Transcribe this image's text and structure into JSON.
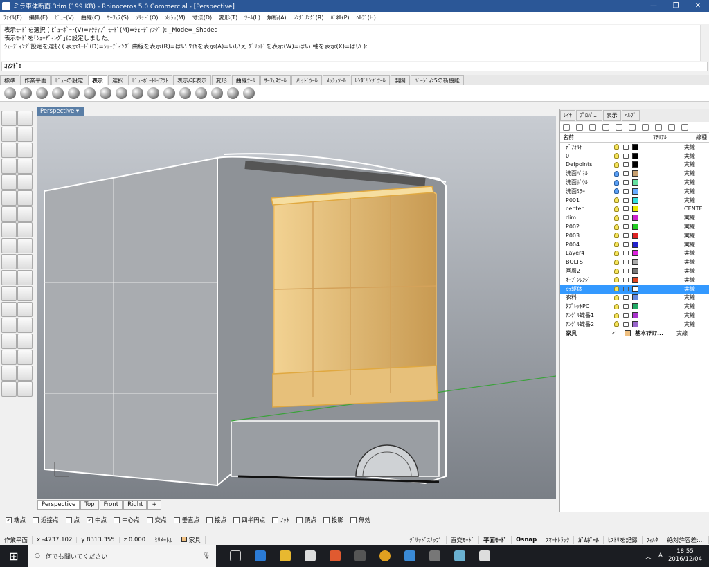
{
  "window": {
    "title": "ミラ車体断面.3dm (199 KB) - Rhinoceros 5.0 Commercial - [Perspective]",
    "minimize": "—",
    "maximize": "❐",
    "close": "✕"
  },
  "menu": [
    "ﾌｧｲﾙ(F)",
    "編集(E)",
    "ﾋﾞｭｰ(V)",
    "曲線(C)",
    "ｻｰﾌｪｽ(S)",
    "ｿﾘｯﾄﾞ(O)",
    "ﾒｯｼｭ(M)",
    "寸法(D)",
    "変形(T)",
    "ﾂｰﾙ(L)",
    "解析(A)",
    "ﾚﾝﾀﾞﾘﾝｸﾞ(R)",
    "ﾊﾟﾈﾙ(P)",
    "ﾍﾙﾌﾟ(H)"
  ],
  "command_history": [
    "表示ﾓｰﾄﾞを選択 ( ﾋﾞｭｰﾎﾟｰﾄ(V)=ｱｸﾃｨﾌﾞ ﾓｰﾄﾞ(M)=ｼｪｰﾃﾞｨﾝｸﾞ ): _Mode=_Shaded",
    "表示ﾓｰﾄﾞを｢ｼｪｰﾃﾞｨﾝｸﾞ｣に設定しました。",
    "ｼｪｰﾃﾞｨﾝｸﾞ設定を選択 ( 表示ﾓｰﾄﾞ(D)=ｼｪｰﾃﾞｨﾝｸﾞ 曲線を表示(R)=はい ﾜｲﾔを表示(A)=いいえ ｸﾞﾘｯﾄﾞを表示(W)=はい 軸を表示(X)=はい ):"
  ],
  "command_prompt": "ｺﾏﾝﾄﾞ:",
  "toolbar_tabs": [
    "標準",
    "作業平面",
    "ﾋﾞｭｰの設定",
    "表示",
    "選択",
    "ﾋﾞｭｰﾎﾟｰﾄﾚｲｱｳﾄ",
    "表示/非表示",
    "変形",
    "曲線ﾂｰﾙ",
    "ｻｰﾌｪｽﾂｰﾙ",
    "ｿﾘｯﾄﾞﾂｰﾙ",
    "ﾒｯｼｭﾂｰﾙ",
    "ﾚﾝﾀﾞﾘﾝｸﾞﾂｰﾙ",
    "製図",
    "ﾊﾞｰｼﾞｮﾝ5の新機能"
  ],
  "active_tab": "表示",
  "viewport": {
    "label": "Perspective",
    "tabs": [
      "Perspective",
      "Top",
      "Front",
      "Right"
    ],
    "add_tab": "+"
  },
  "panel": {
    "tabs": [
      "ﾚｲﾔ",
      "ﾌﾟﾛﾊﾟ...",
      "表示",
      "ﾍﾙﾌﾟ"
    ],
    "columns": {
      "name": "名前",
      "material": "ﾏﾃﾘｱﾙ",
      "linetype": "線種"
    },
    "layers": [
      {
        "name": "ﾃﾞﾌｫﾙﾄ",
        "color": "#000000",
        "bulb": "yellow",
        "linetype": "実線"
      },
      {
        "name": "0",
        "color": "#000000",
        "bulb": "yellow",
        "linetype": "実線"
      },
      {
        "name": "Defpoints",
        "color": "#000000",
        "bulb": "yellow",
        "linetype": "実線"
      },
      {
        "name": "洗面ﾊﾟﾈﾙ",
        "color": "#c8a070",
        "bulb": "blue",
        "linetype": "実線"
      },
      {
        "name": "洗面ﾎﾞｳﾙ",
        "color": "#66e0a0",
        "bulb": "blue",
        "linetype": "実線"
      },
      {
        "name": "洗面ﾐﾗｰ",
        "color": "#66aaff",
        "bulb": "blue",
        "linetype": "実線"
      },
      {
        "name": "P001",
        "color": "#33dddd",
        "bulb": "yellow",
        "linetype": "実線"
      },
      {
        "name": "center",
        "color": "#e8e800",
        "bulb": "yellow",
        "linetype": "CENTE"
      },
      {
        "name": "dim",
        "color": "#cc22cc",
        "bulb": "yellow",
        "linetype": "実線"
      },
      {
        "name": "P002",
        "color": "#22cc22",
        "bulb": "yellow",
        "linetype": "実線"
      },
      {
        "name": "P003",
        "color": "#dd2222",
        "bulb": "yellow",
        "linetype": "実線"
      },
      {
        "name": "P004",
        "color": "#2222cc",
        "bulb": "yellow",
        "linetype": "実線"
      },
      {
        "name": "Layer4",
        "color": "#dd22dd",
        "bulb": "yellow",
        "linetype": "実線"
      },
      {
        "name": "BOLTS",
        "color": "#aaaaaa",
        "bulb": "yellow",
        "linetype": "実線"
      },
      {
        "name": "画層2",
        "color": "#777777",
        "bulb": "yellow",
        "linetype": "実線"
      },
      {
        "name": "ｵｰﾌﾟﾝﾚﾝｼﾞ",
        "color": "#dd4422",
        "bulb": "yellow",
        "linetype": "実線"
      },
      {
        "name": "ﾐﾗ躯体",
        "color": "#ffffff",
        "bulb": "yellow",
        "linetype": "実線",
        "selected": true
      },
      {
        "name": "衣料",
        "color": "#6688dd",
        "bulb": "yellow",
        "linetype": "実線"
      },
      {
        "name": "ﾀﾌﾞﾚｯﾄPC",
        "color": "#22aa66",
        "bulb": "yellow",
        "linetype": "実線"
      },
      {
        "name": "ｱﾝｸﾞﾙ蝶番1",
        "color": "#aa33cc",
        "bulb": "yellow",
        "linetype": "実線"
      },
      {
        "name": "ｱﾝｸﾞﾙ蝶番2",
        "color": "#9966cc",
        "bulb": "yellow",
        "linetype": "実線"
      },
      {
        "name": "家具",
        "color": "#f0c080",
        "bulb": "none",
        "linetype": "実線",
        "check": "✓",
        "material": "基本ﾏﾃﾘｱ..."
      }
    ]
  },
  "osnap": [
    {
      "label": "端点",
      "checked": true
    },
    {
      "label": "近接点",
      "checked": false
    },
    {
      "label": "点",
      "checked": false
    },
    {
      "label": "中点",
      "checked": true
    },
    {
      "label": "中心点",
      "checked": false
    },
    {
      "label": "交点",
      "checked": false
    },
    {
      "label": "垂直点",
      "checked": false
    },
    {
      "label": "接点",
      "checked": false
    },
    {
      "label": "四半円点",
      "checked": false
    },
    {
      "label": "ﾉｯﾄ",
      "checked": false
    },
    {
      "label": "頂点",
      "checked": false
    },
    {
      "label": "投影",
      "checked": false
    },
    {
      "label": "無効",
      "checked": false
    }
  ],
  "status": {
    "cplane": "作業平面",
    "x": "x -4737.102",
    "y": "y 8313.355",
    "z": "z 0.000",
    "units": "ﾐﾘﾒｰﾄﾙ",
    "layer": "家具",
    "grid_snap": "ｸﾞﾘｯﾄﾞｽﾅｯﾌﾟ",
    "ortho": "直交ﾓｰﾄﾞ",
    "planar": "平面ﾓｰﾄﾞ",
    "osnap": "Osnap",
    "smarttrack": "ｽﾏｰﾄﾄﾗｯｸ",
    "gumball": "ｶﾞﾑﾎﾞｰﾙ",
    "history": "ﾋｽﾄﾘを記録",
    "filter": "ﾌｨﾙﾀ",
    "tolerance": "絶対許容差:..."
  },
  "taskbar": {
    "search_placeholder": "何でも聞いてください",
    "time": "18:55",
    "date": "2016/12/04",
    "ime": "A"
  }
}
